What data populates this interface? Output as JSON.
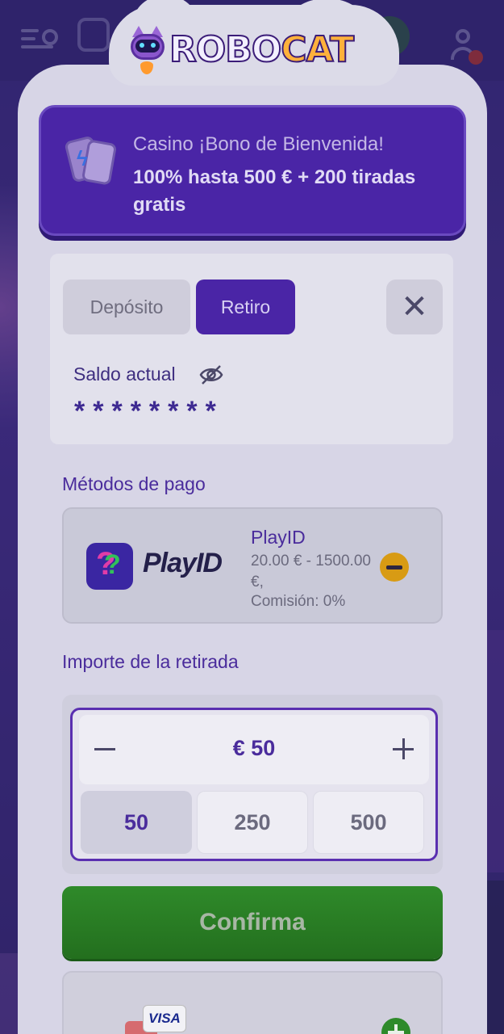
{
  "brand": {
    "logo_part1": "ROBO",
    "logo_part2": "CAT"
  },
  "bonus": {
    "line1": "Casino ¡Bono de Bienvenida!",
    "line2": "100% hasta 500 € + 200 tiradas gratis"
  },
  "tabs": {
    "deposit": "Depósito",
    "withdraw": "Retiro",
    "active": "Retiro"
  },
  "balance": {
    "label": "Saldo actual",
    "masked_value": "********"
  },
  "payment_methods": {
    "title": "Métodos de pago",
    "selected": {
      "name": "PlayID",
      "logo_text": "PlayID",
      "range": "20.00 € - 1500.00 €,",
      "fee": "Comisión: 0%"
    },
    "second_card_badge": "VISA"
  },
  "amount": {
    "title": "Importe de la retirada",
    "value": "€ 50",
    "presets": [
      "50",
      "250",
      "500"
    ],
    "selected_preset": "50"
  },
  "confirm": {
    "label": "Confirma"
  },
  "colors": {
    "accent_purple": "#4a25a6",
    "confirm_green": "#2f8a2a",
    "method_action_yellow": "#d89b14"
  }
}
